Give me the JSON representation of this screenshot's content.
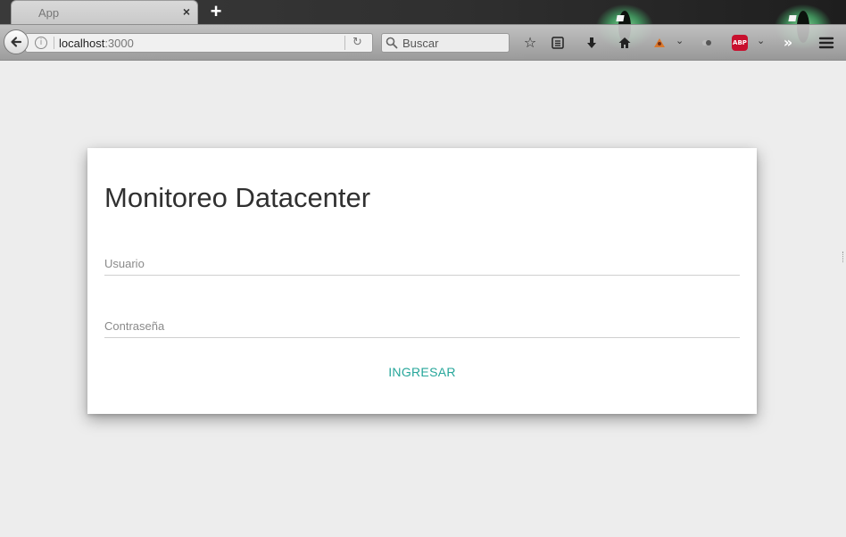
{
  "browser": {
    "tab": {
      "title": "App",
      "close_glyph": "×"
    },
    "new_tab_glyph": "+",
    "url": {
      "host": "localhost",
      "port": ":3000"
    },
    "search": {
      "placeholder": "Buscar"
    },
    "toolbar_icons": [
      "back-arrow-icon",
      "info-icon",
      "reload-icon",
      "search-icon",
      "bookmark-star-icon",
      "reading-list-icon",
      "download-icon",
      "home-icon",
      "extension-icon",
      "chevron-down-icon",
      "extension-icon",
      "adblock-plus-icon",
      "chevron-down-icon",
      "overflow-icon",
      "menu-icon"
    ],
    "adblock_label": "ABP"
  },
  "login": {
    "title": "Monitoreo Datacenter",
    "username_label": "Usuario",
    "password_label": "Contraseña",
    "submit_label": "INGRESAR"
  },
  "colors": {
    "page_background": "#ededed",
    "card_background": "#ffffff",
    "accent": "#26a69a",
    "abp_red": "#c8102e"
  }
}
